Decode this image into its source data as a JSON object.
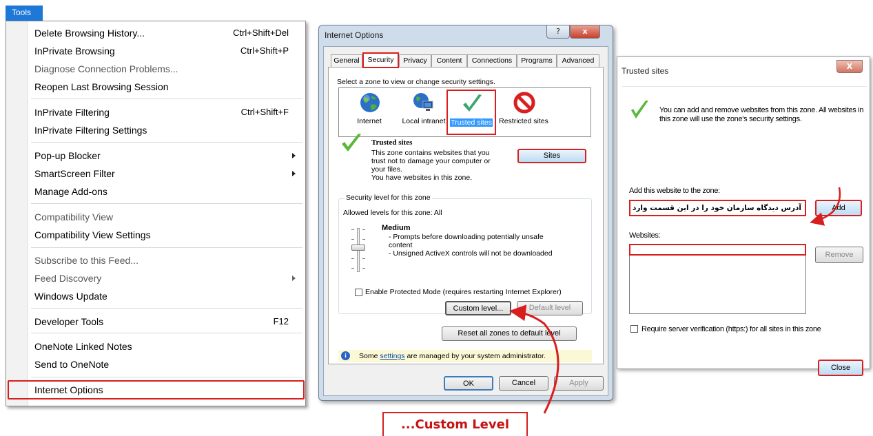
{
  "tools_menu": {
    "tab_label": "Tools",
    "items": [
      {
        "label": "Delete Browsing History...",
        "shortcut": "Ctrl+Shift+Del"
      },
      {
        "label": "InPrivate Browsing",
        "shortcut": "Ctrl+Shift+P"
      },
      {
        "label": "Diagnose Connection Problems...",
        "disabled": true
      },
      {
        "label": "Reopen Last Browsing Session"
      },
      {
        "label": "InPrivate Filtering",
        "shortcut": "Ctrl+Shift+F"
      },
      {
        "label": "InPrivate Filtering Settings"
      },
      {
        "label": "Pop-up Blocker",
        "submenu": true
      },
      {
        "label": "SmartScreen Filter",
        "submenu": true
      },
      {
        "label": "Manage Add-ons"
      },
      {
        "label": "Compatibility View",
        "disabled": true
      },
      {
        "label": "Compatibility View Settings"
      },
      {
        "label": "Subscribe to this Feed...",
        "disabled": true
      },
      {
        "label": "Feed Discovery",
        "disabled": true,
        "submenu": true
      },
      {
        "label": "Windows Update"
      },
      {
        "label": "Developer Tools",
        "shortcut": "F12"
      },
      {
        "label": "OneNote Linked Notes"
      },
      {
        "label": "Send to OneNote"
      },
      {
        "label": "Internet Options",
        "highlighted": true
      }
    ]
  },
  "internet_options": {
    "title": "Internet Options",
    "help_btn": "?",
    "close_btn": "x",
    "tabs": [
      "General",
      "Security",
      "Privacy",
      "Content",
      "Connections",
      "Programs",
      "Advanced"
    ],
    "active_tab": "Security",
    "zone_prompt": "Select a zone to view or change security settings.",
    "zones": [
      {
        "label": "Internet",
        "icon": "globe-icon"
      },
      {
        "label": "Local intranet",
        "icon": "intranet-icon"
      },
      {
        "label": "Trusted sites",
        "icon": "checkmark-icon"
      },
      {
        "label": "Restricted sites",
        "icon": "restricted-icon"
      }
    ],
    "zone_info_title": "Trusted sites",
    "zone_info_lines": [
      "This zone contains websites that you",
      "trust not to damage your computer or",
      "your files.",
      "You have websites in this zone."
    ],
    "sites_btn": "Sites",
    "security_level_legend": "Security level for this zone",
    "allowed_levels": "Allowed levels for this zone: All",
    "level_name": "Medium",
    "level_desc": [
      "- Prompts before downloading potentially unsafe",
      "content",
      "- Unsigned ActiveX controls will not be downloaded"
    ],
    "protected_mode": "Enable Protected Mode (requires restarting Internet Explorer)",
    "custom_level_btn": "Custom level...",
    "default_level_btn": "Default level",
    "reset_btn": "Reset all zones to default level",
    "info_prefix": "Some ",
    "info_link": "settings",
    "info_suffix": " are managed by your system administrator.",
    "ok_btn": "OK",
    "cancel_btn": "Cancel",
    "apply_btn": "Apply"
  },
  "trusted_sites": {
    "title": "Trusted sites",
    "close_btn": "X",
    "intro": "You can add and remove websites from this zone. All websites in this zone will use the zone's security settings.",
    "add_label": "Add this website to the zone:",
    "add_value": "آدرس دیدگاه سازمان خود را در این قسمت وارد نمایید",
    "add_btn": "Add",
    "websites_label": "Websites:",
    "remove_btn": "Remove",
    "require_https": "Require server verification (https:) for all sites in this zone",
    "close_label": "Close"
  },
  "annotation": {
    "callout_text": "...Custom Level"
  },
  "colors": {
    "highlight_red": "#d81e1e",
    "menu_accent": "#1e78d7",
    "selection_blue": "#3399ff"
  }
}
